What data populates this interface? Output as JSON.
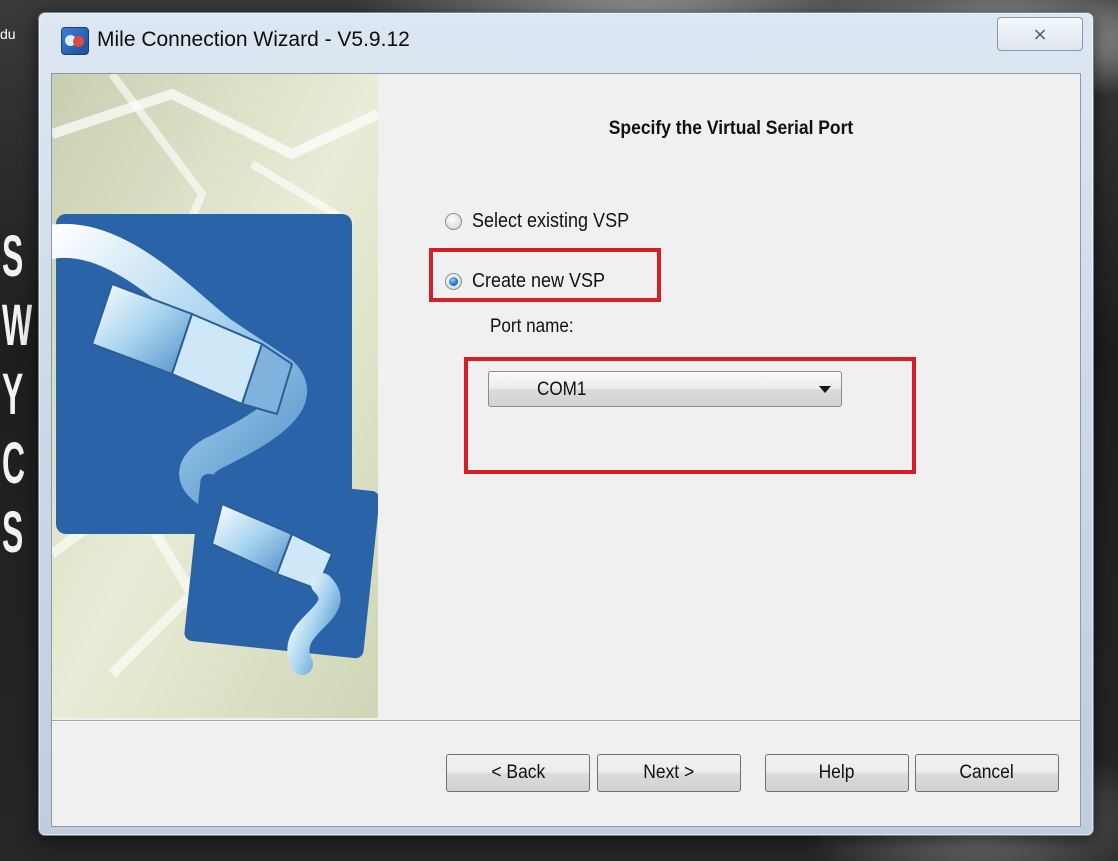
{
  "background": {
    "letters": [
      "S",
      "W",
      "Y",
      "C",
      "S"
    ],
    "corner_text": "du"
  },
  "window": {
    "title": "Mile Connection Wizard - V5.9.12",
    "close_glyph": "⨯"
  },
  "page": {
    "heading": "Specify the Virtual Serial Port",
    "options": [
      {
        "label": "Select existing VSP",
        "checked": false
      },
      {
        "label": "Create new VSP",
        "checked": true
      }
    ],
    "port_name_label": "Port name:",
    "port_select": {
      "value": "COM1"
    }
  },
  "buttons": {
    "back": "< Back",
    "next": "Next >",
    "help": "Help",
    "cancel": "Cancel"
  },
  "colors": {
    "highlight": "#d41f26",
    "side_panel_blue": "#2a63a8"
  }
}
